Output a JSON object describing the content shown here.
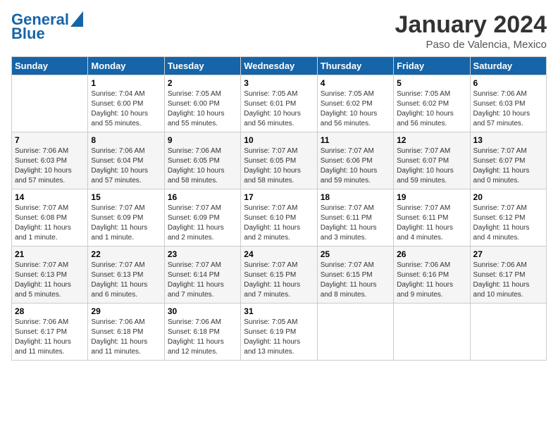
{
  "header": {
    "logo_line1": "General",
    "logo_line2": "Blue",
    "month": "January 2024",
    "location": "Paso de Valencia, Mexico"
  },
  "days_of_week": [
    "Sunday",
    "Monday",
    "Tuesday",
    "Wednesday",
    "Thursday",
    "Friday",
    "Saturday"
  ],
  "weeks": [
    [
      {
        "day": "",
        "info": ""
      },
      {
        "day": "1",
        "info": "Sunrise: 7:04 AM\nSunset: 6:00 PM\nDaylight: 10 hours\nand 55 minutes."
      },
      {
        "day": "2",
        "info": "Sunrise: 7:05 AM\nSunset: 6:00 PM\nDaylight: 10 hours\nand 55 minutes."
      },
      {
        "day": "3",
        "info": "Sunrise: 7:05 AM\nSunset: 6:01 PM\nDaylight: 10 hours\nand 56 minutes."
      },
      {
        "day": "4",
        "info": "Sunrise: 7:05 AM\nSunset: 6:02 PM\nDaylight: 10 hours\nand 56 minutes."
      },
      {
        "day": "5",
        "info": "Sunrise: 7:05 AM\nSunset: 6:02 PM\nDaylight: 10 hours\nand 56 minutes."
      },
      {
        "day": "6",
        "info": "Sunrise: 7:06 AM\nSunset: 6:03 PM\nDaylight: 10 hours\nand 57 minutes."
      }
    ],
    [
      {
        "day": "7",
        "info": "Sunrise: 7:06 AM\nSunset: 6:03 PM\nDaylight: 10 hours\nand 57 minutes."
      },
      {
        "day": "8",
        "info": "Sunrise: 7:06 AM\nSunset: 6:04 PM\nDaylight: 10 hours\nand 57 minutes."
      },
      {
        "day": "9",
        "info": "Sunrise: 7:06 AM\nSunset: 6:05 PM\nDaylight: 10 hours\nand 58 minutes."
      },
      {
        "day": "10",
        "info": "Sunrise: 7:07 AM\nSunset: 6:05 PM\nDaylight: 10 hours\nand 58 minutes."
      },
      {
        "day": "11",
        "info": "Sunrise: 7:07 AM\nSunset: 6:06 PM\nDaylight: 10 hours\nand 59 minutes."
      },
      {
        "day": "12",
        "info": "Sunrise: 7:07 AM\nSunset: 6:07 PM\nDaylight: 10 hours\nand 59 minutes."
      },
      {
        "day": "13",
        "info": "Sunrise: 7:07 AM\nSunset: 6:07 PM\nDaylight: 11 hours\nand 0 minutes."
      }
    ],
    [
      {
        "day": "14",
        "info": "Sunrise: 7:07 AM\nSunset: 6:08 PM\nDaylight: 11 hours\nand 1 minute."
      },
      {
        "day": "15",
        "info": "Sunrise: 7:07 AM\nSunset: 6:09 PM\nDaylight: 11 hours\nand 1 minute."
      },
      {
        "day": "16",
        "info": "Sunrise: 7:07 AM\nSunset: 6:09 PM\nDaylight: 11 hours\nand 2 minutes."
      },
      {
        "day": "17",
        "info": "Sunrise: 7:07 AM\nSunset: 6:10 PM\nDaylight: 11 hours\nand 2 minutes."
      },
      {
        "day": "18",
        "info": "Sunrise: 7:07 AM\nSunset: 6:11 PM\nDaylight: 11 hours\nand 3 minutes."
      },
      {
        "day": "19",
        "info": "Sunrise: 7:07 AM\nSunset: 6:11 PM\nDaylight: 11 hours\nand 4 minutes."
      },
      {
        "day": "20",
        "info": "Sunrise: 7:07 AM\nSunset: 6:12 PM\nDaylight: 11 hours\nand 4 minutes."
      }
    ],
    [
      {
        "day": "21",
        "info": "Sunrise: 7:07 AM\nSunset: 6:13 PM\nDaylight: 11 hours\nand 5 minutes."
      },
      {
        "day": "22",
        "info": "Sunrise: 7:07 AM\nSunset: 6:13 PM\nDaylight: 11 hours\nand 6 minutes."
      },
      {
        "day": "23",
        "info": "Sunrise: 7:07 AM\nSunset: 6:14 PM\nDaylight: 11 hours\nand 7 minutes."
      },
      {
        "day": "24",
        "info": "Sunrise: 7:07 AM\nSunset: 6:15 PM\nDaylight: 11 hours\nand 7 minutes."
      },
      {
        "day": "25",
        "info": "Sunrise: 7:07 AM\nSunset: 6:15 PM\nDaylight: 11 hours\nand 8 minutes."
      },
      {
        "day": "26",
        "info": "Sunrise: 7:06 AM\nSunset: 6:16 PM\nDaylight: 11 hours\nand 9 minutes."
      },
      {
        "day": "27",
        "info": "Sunrise: 7:06 AM\nSunset: 6:17 PM\nDaylight: 11 hours\nand 10 minutes."
      }
    ],
    [
      {
        "day": "28",
        "info": "Sunrise: 7:06 AM\nSunset: 6:17 PM\nDaylight: 11 hours\nand 11 minutes."
      },
      {
        "day": "29",
        "info": "Sunrise: 7:06 AM\nSunset: 6:18 PM\nDaylight: 11 hours\nand 11 minutes."
      },
      {
        "day": "30",
        "info": "Sunrise: 7:06 AM\nSunset: 6:18 PM\nDaylight: 11 hours\nand 12 minutes."
      },
      {
        "day": "31",
        "info": "Sunrise: 7:05 AM\nSunset: 6:19 PM\nDaylight: 11 hours\nand 13 minutes."
      },
      {
        "day": "",
        "info": ""
      },
      {
        "day": "",
        "info": ""
      },
      {
        "day": "",
        "info": ""
      }
    ]
  ]
}
